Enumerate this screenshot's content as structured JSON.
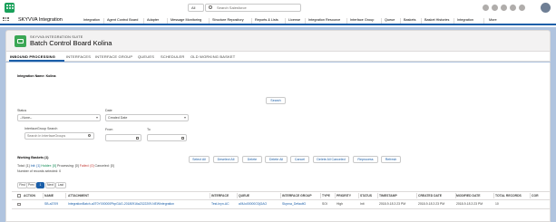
{
  "global_header": {
    "scope_label": "All",
    "search_placeholder": "Search Salesforce"
  },
  "nav": {
    "app_name": "SKYVVA Integration",
    "items": [
      "Integration",
      "Agent Control Board",
      "Adapter",
      "Message Monitoring",
      "Structure Repository",
      "Reports & Lists",
      "License",
      "Integration Resource",
      "Interface Group",
      "Queue",
      "Baskets",
      "Basket Histories",
      "Integration",
      "More"
    ]
  },
  "page_header": {
    "subtitle": "SKYVVA INTEGRATION SUITE",
    "title": "Batch Control Board Kolina"
  },
  "tabs": [
    "INBOUND PROCESSING",
    "INTERFACES",
    "INTERFACE GROUP",
    "QUEUES",
    "SCHEDULER",
    "OLD WORKING BASKET"
  ],
  "filters": {
    "integration_label": "Integration Name:",
    "integration_value": "Kolina",
    "search_button": "Search",
    "status_label": "Status",
    "status_value": "--None--",
    "date_label": "Date",
    "date_value": "Created Date",
    "ifgroup_label": "InterfaceGroup Search",
    "ifgroup_placeholder": "Search In InterfaceGroups",
    "from_label": "From",
    "to_label": "To"
  },
  "working": {
    "title": "Working Baskets (1)",
    "total": "Total: [1]",
    "init": "Init: [1]",
    "holder": "Holder: [0]",
    "processing": "Processing: [0]",
    "failed": "Failed: [0]",
    "canceled": "Canceled: [0]",
    "selected": "Number of records selected: 0"
  },
  "actions": [
    "Select All",
    "Deselect All",
    "Delete",
    "Delete All",
    "Cancel",
    "Delete All Canceled",
    "Reprocess",
    "Refresh"
  ],
  "pager": [
    "First",
    "Prev",
    "1",
    "Next",
    "Last"
  ],
  "table": {
    "columns": [
      "ACTION",
      "NAME",
      "ATTACHMENT",
      "INTERFACE",
      "QUEUE",
      "INTERFACE GROUP",
      "TYPE",
      "PRIORITY",
      "STATUS",
      "TIMESTAMP",
      "CREATED DATE",
      "MODIFIED DATE",
      "TOTAL RECORDS",
      "COR"
    ],
    "rows": [
      [
        "",
        "SB-a3709",
        "IntegrationBatch-a0T0Y000000PbpGAG-20180916a2322209-NEWIntegration",
        "Test-Inyn-AC",
        "a0iUo00000O3jGAO",
        "Skyvva_DefaultG",
        "SOI",
        "High",
        "Init",
        "2018-9-18 2:23 PM",
        "2018-9-18 2:23 PM",
        "2018-9-18 2:23 PM",
        "10",
        ""
      ]
    ]
  },
  "colors": {
    "brand_blue": "#1a5ea8",
    "page_bg": "#b0c4df",
    "icon_green": "#3ba755",
    "holder_green": "#04844b",
    "failed_red": "#c23934"
  }
}
